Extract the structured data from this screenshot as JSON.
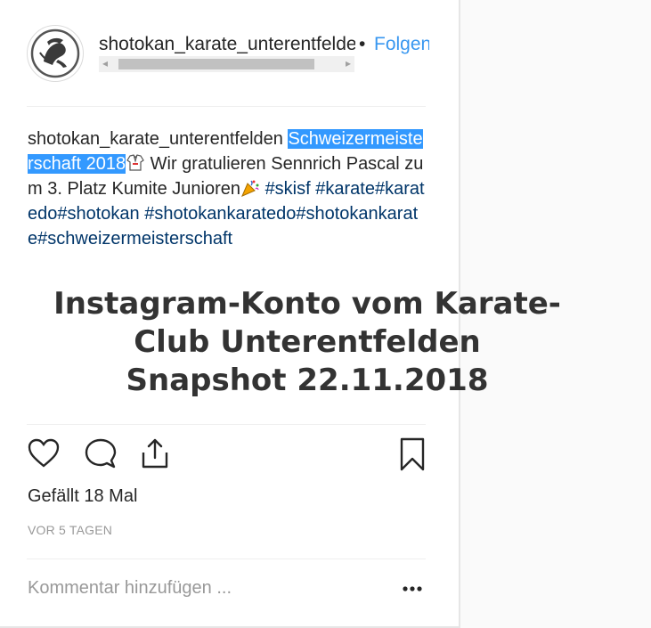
{
  "post": {
    "username": "shotokan_karate_unterentfelden",
    "follow_separator": "•",
    "follow_label": "Folgen"
  },
  "caption": {
    "username": "shotokan_karate_unterentfelden",
    "highlighted": "Schweizermeisterschaft 2018",
    "text": " Wir gratulieren Sennrich Pascal zum 3. Platz Kumite Junioren",
    "hashtags": [
      "#skisf",
      "#karate",
      "#karatedo",
      "#shotokan",
      "#shotokankaratedo",
      "#shotokankarate",
      "#schweizermeisterschaft"
    ]
  },
  "overlay": {
    "line1": "Instagram-Konto vom Karate-",
    "line2": "Club Unterentfelden",
    "line3": "Snapshot 22.11.2018"
  },
  "engagement": {
    "likes": "Gefällt 18 Mal",
    "time": "VOR 5 TAGEN"
  },
  "comment": {
    "placeholder": "Kommentar hinzufügen ..."
  },
  "icons": {
    "like": "heart-icon",
    "comment": "speech-bubble-icon",
    "share": "share-icon",
    "save": "bookmark-icon",
    "more": "more-options-icon"
  },
  "colors": {
    "link": "#3897f0",
    "hashtag": "#003569",
    "highlight": "#3399ff"
  }
}
